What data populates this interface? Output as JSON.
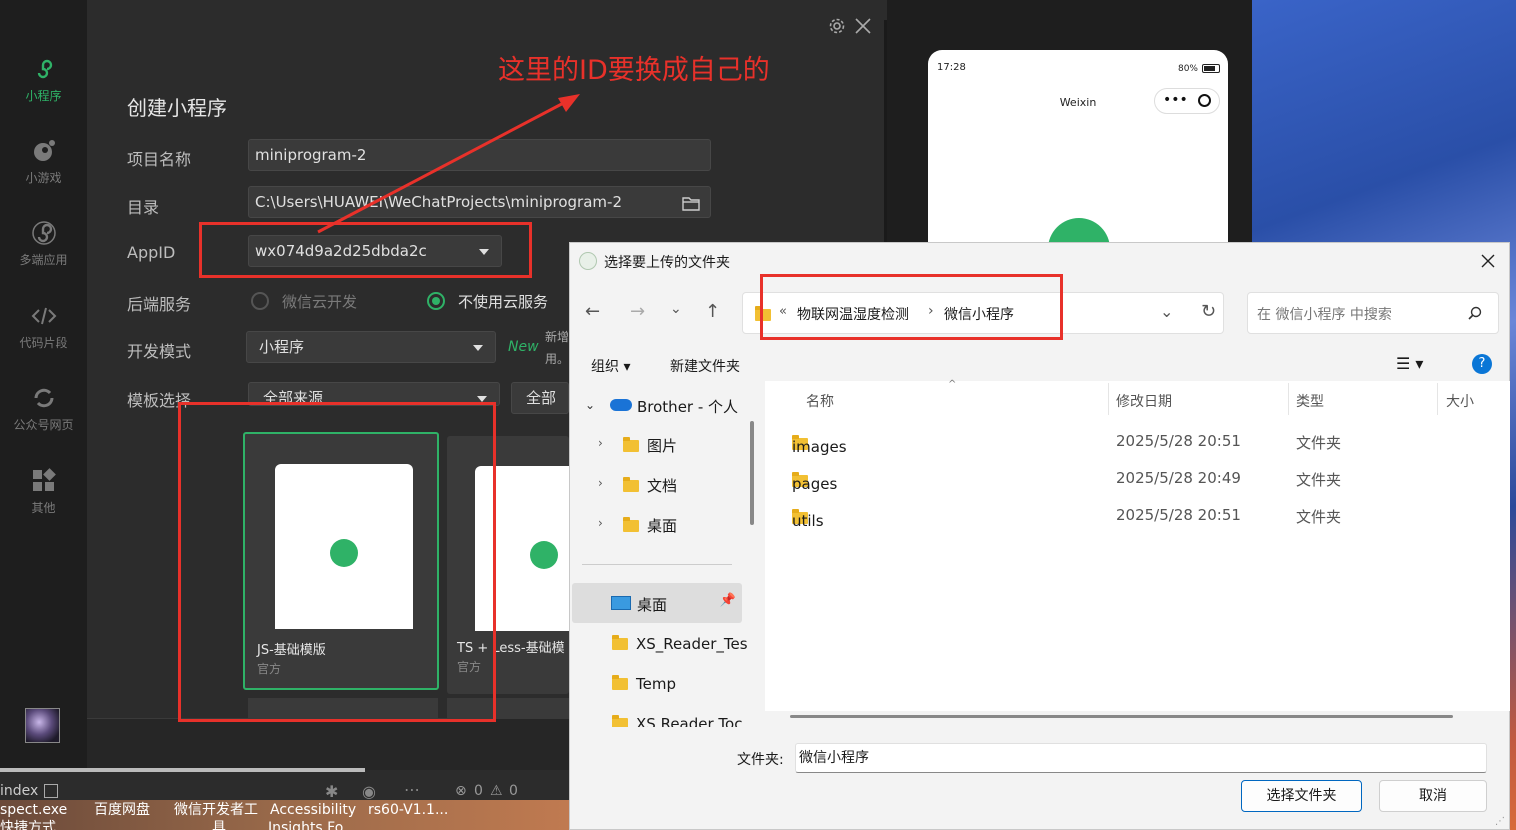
{
  "sidebar": {
    "items": [
      {
        "label": "小程序"
      },
      {
        "label": "小游戏"
      },
      {
        "label": "多端应用"
      },
      {
        "label": "代码片段"
      },
      {
        "label": "公众号网页"
      },
      {
        "label": "其他"
      }
    ]
  },
  "form": {
    "title": "创建小程序",
    "name_label": "项目名称",
    "name_value": "miniprogram-2",
    "dir_label": "目录",
    "dir_value": "C:\\Users\\HUAWEI\\WeChatProjects\\miniprogram-2",
    "appid_label": "AppID",
    "appid_value": "wx074d9a2d25dbda2c",
    "backend_label": "后端服务",
    "backend_opt1": "微信云开发",
    "backend_opt2": "不使用云服务",
    "mode_label": "开发模式",
    "mode_value": "小程序",
    "mode_new": "New",
    "mode_note_line1": "新增",
    "mode_note_line2": "用。",
    "template_label": "模板选择",
    "template_source": "全部来源",
    "template_filter": "全部分"
  },
  "templates": [
    {
      "name": "JS-基础模版",
      "sub": "官方"
    },
    {
      "name": "TS + Less-基础模",
      "sub": "官方"
    }
  ],
  "annotation": {
    "text": "这里的ID要换成自己的"
  },
  "preview": {
    "time": "17:28",
    "battery": "80%",
    "title": "Weixin"
  },
  "devtools_bottom": {
    "index": "index",
    "errors": "0",
    "warnings": "0"
  },
  "taskbar": {
    "items": [
      "spect.exe",
      "百度网盘",
      "微信开发者工",
      "Accessibility",
      "rs60-V1.1..."
    ],
    "line2": [
      "快捷方式",
      "具",
      "Insights Fo"
    ]
  },
  "dialog": {
    "title": "选择要上传的文件夹",
    "breadcrumb_prefix": "«",
    "breadcrumb": [
      "物联网温湿度检测",
      "微信小程序"
    ],
    "search_placeholder": "在 微信小程序 中搜索",
    "organize": "组织",
    "new_folder": "新建文件夹",
    "columns": {
      "name": "名称",
      "date": "修改日期",
      "type": "类型",
      "size": "大小"
    },
    "files": [
      {
        "name": "images",
        "date": "2025/5/28 20:51",
        "type": "文件夹"
      },
      {
        "name": "pages",
        "date": "2025/5/28 20:49",
        "type": "文件夹"
      },
      {
        "name": "utils",
        "date": "2025/5/28 20:51",
        "type": "文件夹"
      }
    ],
    "nav": {
      "cloud": "Brother - 个人",
      "sub": [
        "图片",
        "文档",
        "桌面"
      ],
      "quick": [
        "桌面",
        "XS_Reader_Tes",
        "Temp",
        "XS Reader Toc"
      ]
    },
    "folder_label": "文件夹:",
    "folder_value": "微信小程序",
    "select_button": "选择文件夹",
    "cancel_button": "取消"
  },
  "colors": {
    "accent": "#2fb267",
    "annotation": "#e8312a",
    "windows_blue": "#0067c0"
  }
}
